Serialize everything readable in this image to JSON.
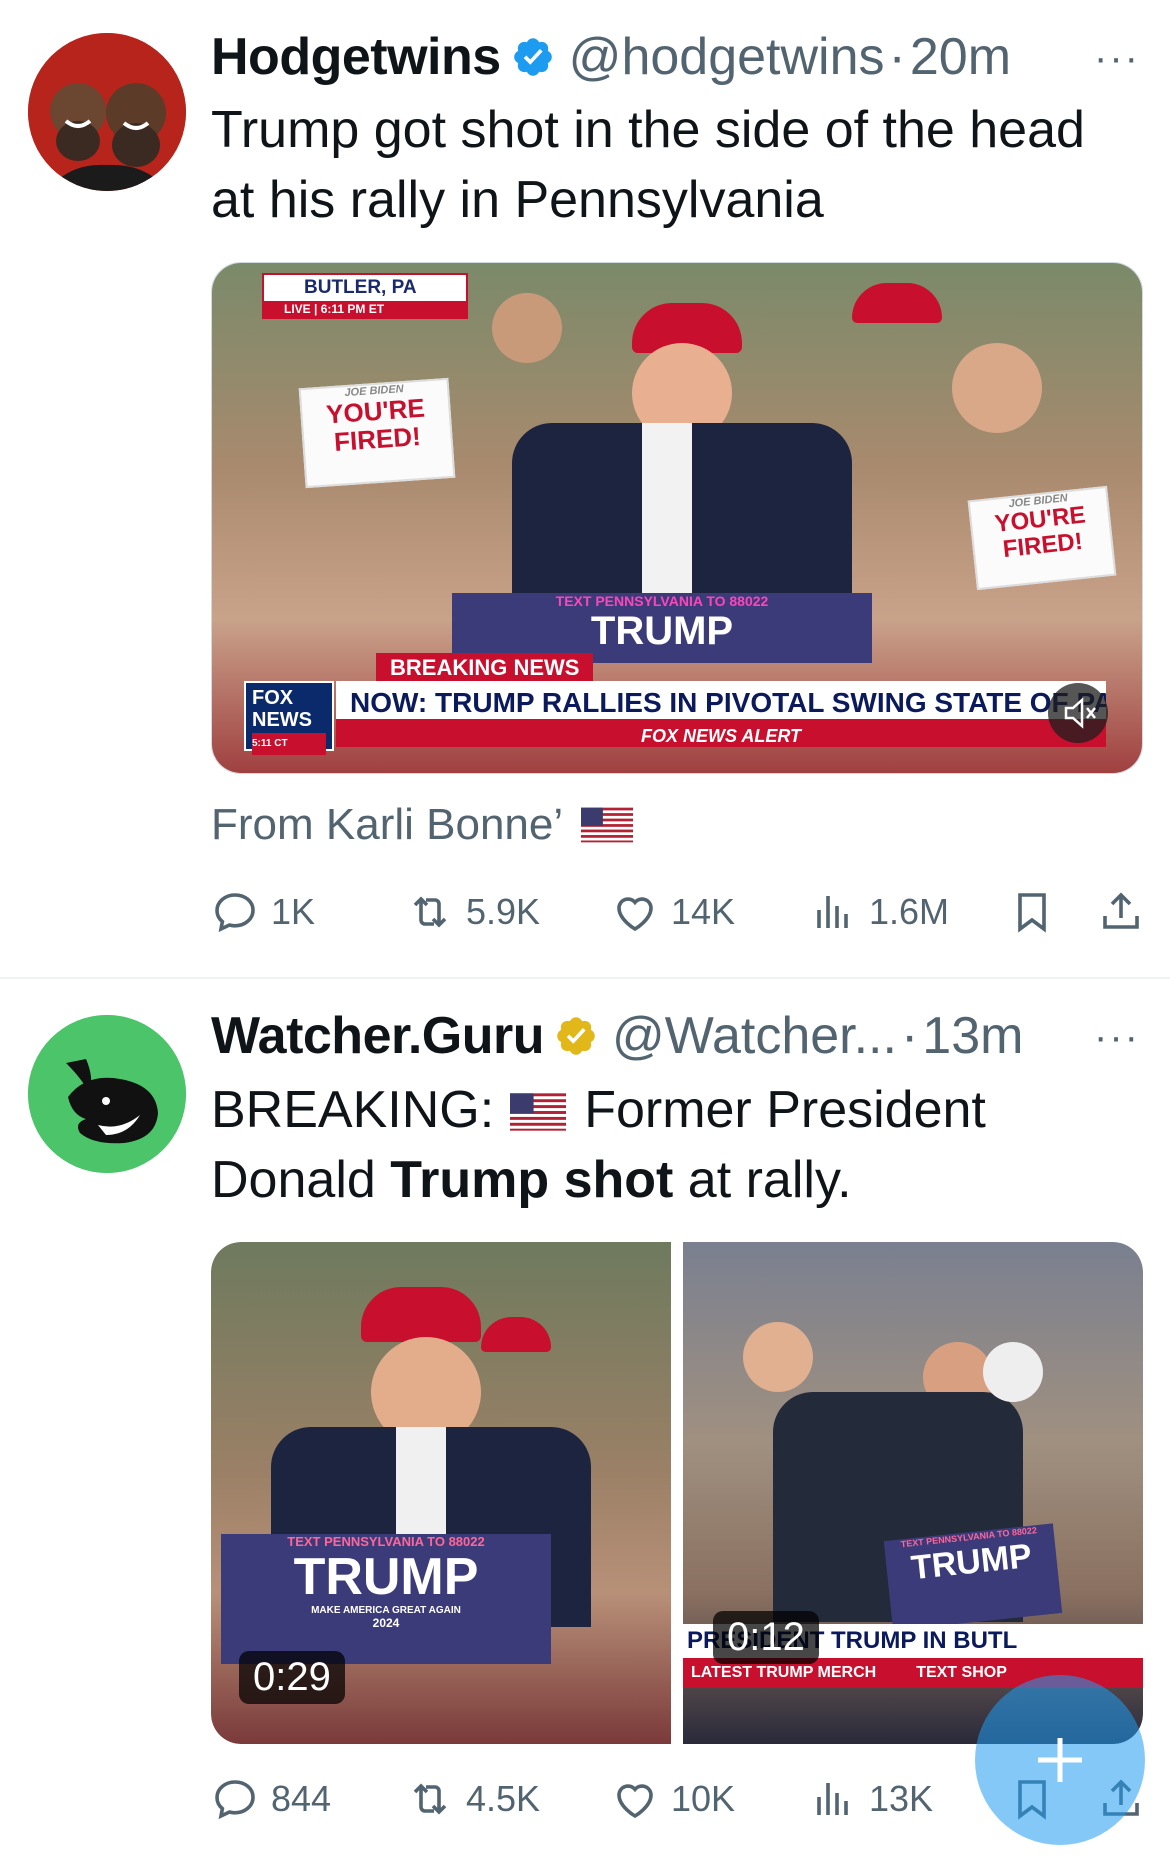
{
  "tweets": [
    {
      "author_name": "Hodgetwins",
      "handle": "@hodgetwins",
      "separator": "·",
      "time": "20m",
      "more": "···",
      "text": "Trump got shot in the side of the head at his rally in Pennsylvania",
      "media": {
        "type": "video",
        "chyron_place": "BUTLER, PA",
        "chyron_live": "LIVE | 6:11 PM ET",
        "sign_left": "YOU'RE FIRED!",
        "sign_left_small": "JOE BIDEN",
        "sign_right_small": "JOE BIDEN",
        "sign_right": "YOU'RE FIRED!",
        "podium_small": "TEXT PENNSYLVANIA TO 88022",
        "podium_big": "TRUMP",
        "breaking": "BREAKING NEWS",
        "headline": "NOW: TRUMP RALLIES IN PIVOTAL SWING STATE OF PA",
        "alert": "FOX NEWS ALERT",
        "fox_logo_line1": "FOX",
        "fox_logo_line2": "NEWS",
        "fox_logo_time": "5:11 CT"
      },
      "from_text": "From Karli Bonne’",
      "stats": {
        "replies": "1K",
        "reposts": "5.9K",
        "likes": "14K",
        "views": "1.6M"
      }
    },
    {
      "author_name": "Watcher.Guru",
      "handle": "@Watcher...",
      "separator": "·",
      "time": "13m",
      "more": "···",
      "text_prefix": "BREAKING:",
      "text_after_flag": "Former President",
      "text_line2_start": "Donald ",
      "text_bold": "Trump shot",
      "text_end": " at rally.",
      "media_left": {
        "duration": "0:29",
        "podium_small": "TEXT PENNSYLVANIA TO 88022",
        "podium_big": "TRUMP",
        "podium_sub": "MAKE AMERICA GREAT AGAIN",
        "podium_year": "2024"
      },
      "media_right": {
        "duration": "0:12",
        "podium_small": "TEXT PENNSYLVANIA TO 88022",
        "podium_big": "TRUMP",
        "banner": "PRESIDENT TRUMP IN BUTL",
        "banner_sub": "LATEST TRUMP MERCH",
        "banner_shop": "TEXT SHOP"
      },
      "stats": {
        "replies": "844",
        "reposts": "4.5K",
        "likes": "10K",
        "views": "13K"
      }
    }
  ],
  "colors": {
    "text_primary": "#0f1419",
    "text_secondary": "#536471",
    "verified_blue": "#1d9bf0",
    "verified_gold": "#e2b719",
    "divider": "#eff3f4"
  },
  "icons": [
    "verified-badge-icon",
    "more-icon",
    "reply-icon",
    "repost-icon",
    "like-icon",
    "views-icon",
    "bookmark-icon",
    "share-icon",
    "mute-icon",
    "us-flag-icon",
    "compose-icon"
  ]
}
